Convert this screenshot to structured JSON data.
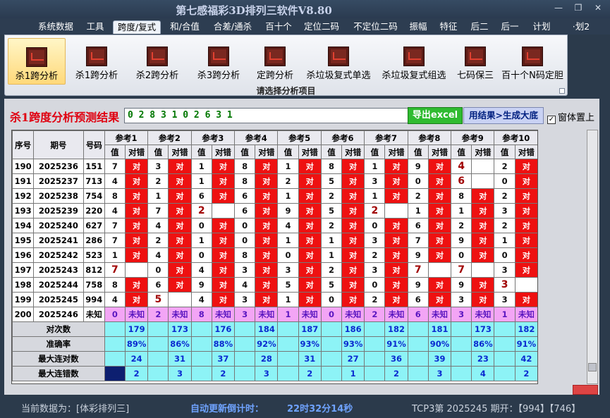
{
  "window": {
    "title": "第七感福彩3D排列三软件V8.80"
  },
  "menu": [
    {
      "label": "系统数据"
    },
    {
      "label": "工具"
    },
    {
      "label": "跨度/复式"
    },
    {
      "label": "和/合值"
    },
    {
      "label": "合差/通杀"
    },
    {
      "label": "百十个"
    },
    {
      "label": "定位二码"
    },
    {
      "label": "不定位二码"
    },
    {
      "label": "振幅"
    },
    {
      "label": "特征"
    },
    {
      "label": "后二"
    },
    {
      "label": "后一"
    },
    {
      "label": "计划"
    },
    {
      "label": "·划2"
    }
  ],
  "ribbon": {
    "caption": "请选择分析项目",
    "items": [
      {
        "label": "杀1跨分析"
      },
      {
        "label": "杀1跨分析"
      },
      {
        "label": "杀2跨分析"
      },
      {
        "label": "杀3跨分析"
      },
      {
        "label": "定跨分析"
      },
      {
        "label": "杀垃圾复式单选"
      },
      {
        "label": "杀垃圾复式组选"
      },
      {
        "label": "七码保三"
      },
      {
        "label": "百十个N码定胆"
      }
    ]
  },
  "panel": {
    "heading": "杀1跨度分析预测结果",
    "result": "0 2 8 3 1 0 2 6 3 1",
    "excel_button": "导出excel",
    "generate_button": "用结果>生成大底",
    "topmost_label": "窗体置上",
    "topmost_checked": "✓"
  },
  "table": {
    "headers": {
      "seq": "序号",
      "period": "期号",
      "code": "号码",
      "refs": [
        "参考1",
        "参考2",
        "参考3",
        "参考4",
        "参考5",
        "参考6",
        "参考7",
        "参考8",
        "参考9",
        "参考10"
      ],
      "val": "值",
      "ok": "对错"
    },
    "rows": [
      {
        "seq": "190",
        "period": "2025236",
        "code": "151",
        "cells": [
          [
            "7",
            "对"
          ],
          [
            "3",
            "对"
          ],
          [
            "1",
            "对"
          ],
          [
            "8",
            "对"
          ],
          [
            "1",
            "对"
          ],
          [
            "8",
            "对"
          ],
          [
            "1",
            "对"
          ],
          [
            "9",
            "对"
          ],
          [
            "4",
            ""
          ],
          [
            "2",
            "对"
          ]
        ]
      },
      {
        "seq": "191",
        "period": "2025237",
        "code": "713",
        "cells": [
          [
            "4",
            "对"
          ],
          [
            "2",
            "对"
          ],
          [
            "1",
            "对"
          ],
          [
            "8",
            "对"
          ],
          [
            "2",
            "对"
          ],
          [
            "5",
            "对"
          ],
          [
            "3",
            "对"
          ],
          [
            "0",
            "对"
          ],
          [
            "6",
            ""
          ],
          [
            "0",
            "对"
          ]
        ]
      },
      {
        "seq": "192",
        "period": "2025238",
        "code": "754",
        "cells": [
          [
            "8",
            "对"
          ],
          [
            "1",
            "对"
          ],
          [
            "6",
            "对"
          ],
          [
            "6",
            "对"
          ],
          [
            "1",
            "对"
          ],
          [
            "2",
            "对"
          ],
          [
            "1",
            "对"
          ],
          [
            "2",
            "对"
          ],
          [
            "8",
            "对"
          ],
          [
            "2",
            "对"
          ]
        ]
      },
      {
        "seq": "193",
        "period": "2025239",
        "code": "220",
        "cells": [
          [
            "4",
            "对"
          ],
          [
            "7",
            "对"
          ],
          [
            "2",
            ""
          ],
          [
            "6",
            "对"
          ],
          [
            "9",
            "对"
          ],
          [
            "5",
            "对"
          ],
          [
            "2",
            ""
          ],
          [
            "1",
            "对"
          ],
          [
            "1",
            "对"
          ],
          [
            "3",
            "对"
          ]
        ]
      },
      {
        "seq": "194",
        "period": "2025240",
        "code": "627",
        "cells": [
          [
            "7",
            "对"
          ],
          [
            "4",
            "对"
          ],
          [
            "0",
            "对"
          ],
          [
            "0",
            "对"
          ],
          [
            "4",
            "对"
          ],
          [
            "2",
            "对"
          ],
          [
            "0",
            "对"
          ],
          [
            "6",
            "对"
          ],
          [
            "2",
            "对"
          ],
          [
            "2",
            "对"
          ]
        ]
      },
      {
        "seq": "195",
        "period": "2025241",
        "code": "286",
        "cells": [
          [
            "7",
            "对"
          ],
          [
            "2",
            "对"
          ],
          [
            "1",
            "对"
          ],
          [
            "0",
            "对"
          ],
          [
            "1",
            "对"
          ],
          [
            "1",
            "对"
          ],
          [
            "3",
            "对"
          ],
          [
            "7",
            "对"
          ],
          [
            "9",
            "对"
          ],
          [
            "1",
            "对"
          ]
        ]
      },
      {
        "seq": "196",
        "period": "2025242",
        "code": "523",
        "cells": [
          [
            "1",
            "对"
          ],
          [
            "4",
            "对"
          ],
          [
            "0",
            "对"
          ],
          [
            "8",
            "对"
          ],
          [
            "0",
            "对"
          ],
          [
            "1",
            "对"
          ],
          [
            "2",
            "对"
          ],
          [
            "9",
            "对"
          ],
          [
            "0",
            "对"
          ],
          [
            "0",
            "对"
          ]
        ]
      },
      {
        "seq": "197",
        "period": "2025243",
        "code": "812",
        "cells": [
          [
            "7",
            ""
          ],
          [
            "0",
            "对"
          ],
          [
            "4",
            "对"
          ],
          [
            "3",
            "对"
          ],
          [
            "3",
            "对"
          ],
          [
            "2",
            "对"
          ],
          [
            "3",
            "对"
          ],
          [
            "7",
            ""
          ],
          [
            "7",
            ""
          ],
          [
            "3",
            "对"
          ]
        ]
      },
      {
        "seq": "198",
        "period": "2025244",
        "code": "758",
        "cells": [
          [
            "8",
            "对"
          ],
          [
            "6",
            "对"
          ],
          [
            "9",
            "对"
          ],
          [
            "4",
            "对"
          ],
          [
            "5",
            "对"
          ],
          [
            "5",
            "对"
          ],
          [
            "0",
            "对"
          ],
          [
            "9",
            "对"
          ],
          [
            "9",
            "对"
          ],
          [
            "3",
            ""
          ]
        ]
      },
      {
        "seq": "199",
        "period": "2025245",
        "code": "994",
        "cells": [
          [
            "4",
            "对"
          ],
          [
            "5",
            ""
          ],
          [
            "4",
            "对"
          ],
          [
            "3",
            "对"
          ],
          [
            "1",
            "对"
          ],
          [
            "0",
            "对"
          ],
          [
            "2",
            "对"
          ],
          [
            "6",
            "对"
          ],
          [
            "3",
            "对"
          ],
          [
            "3",
            "对"
          ]
        ]
      }
    ],
    "pending": {
      "seq": "200",
      "period": "2025246",
      "code": "未知",
      "cells": [
        [
          "0",
          "未知"
        ],
        [
          "2",
          "未知"
        ],
        [
          "8",
          "未知"
        ],
        [
          "3",
          "未知"
        ],
        [
          "1",
          "未知"
        ],
        [
          "0",
          "未知"
        ],
        [
          "2",
          "未知"
        ],
        [
          "6",
          "未知"
        ],
        [
          "3",
          "未知"
        ],
        [
          "1",
          "未知"
        ]
      ]
    },
    "stats": [
      {
        "label": "对次数",
        "values": [
          "179",
          "173",
          "176",
          "184",
          "187",
          "186",
          "182",
          "181",
          "173",
          "182"
        ]
      },
      {
        "label": "准确率",
        "values": [
          "89%",
          "86%",
          "88%",
          "92%",
          "93%",
          "93%",
          "91%",
          "90%",
          "86%",
          "91%"
        ]
      },
      {
        "label": "最大连对数",
        "values": [
          "24",
          "31",
          "37",
          "28",
          "31",
          "27",
          "36",
          "39",
          "23",
          "42"
        ]
      },
      {
        "label": "最大连错数",
        "values": [
          "2",
          "3",
          "2",
          "3",
          "2",
          "1",
          "2",
          "3",
          "4",
          "2"
        ]
      }
    ]
  },
  "status": {
    "current_label": "当前数据为：[体彩排列三]",
    "countdown_label": "自动更新倒计时：",
    "countdown_value": "22时32分14秒",
    "draw_info": "TCP3第 2025245 期开：【994】【746】"
  },
  "colors": {
    "hit": "#ee1111",
    "pending": "#f3a5f5",
    "stat": "#8df3f6",
    "excel": "#2fbb30"
  }
}
